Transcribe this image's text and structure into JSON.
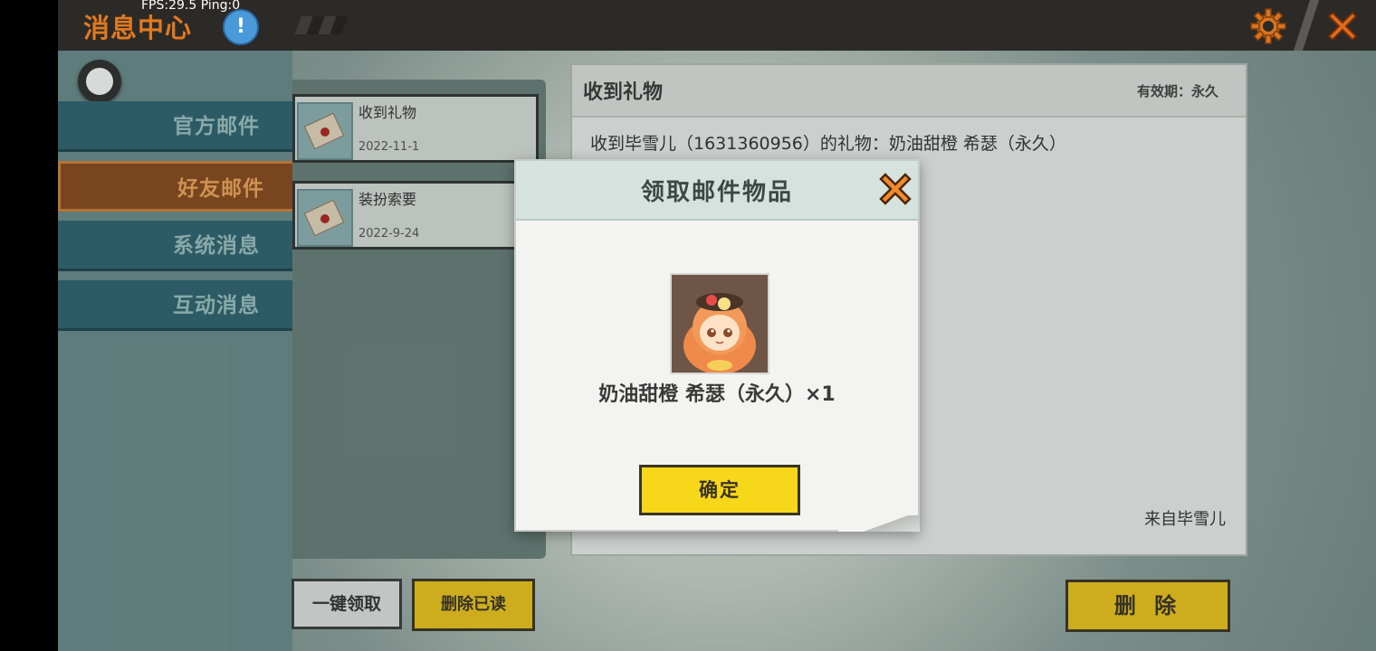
{
  "topbar": {
    "title": "消息中心",
    "fps_text": "FPS:29.5  Ping:0",
    "info_icon": "info-icon",
    "settings_icon": "gear-icon",
    "close_icon": "close-icon"
  },
  "sidebar": {
    "items": [
      {
        "label": "官方邮件"
      },
      {
        "label": "好友邮件"
      },
      {
        "label": "系统消息"
      },
      {
        "label": "互动消息"
      }
    ],
    "active_index": 1
  },
  "mail_list": [
    {
      "title": "收到礼物",
      "date": "2022-11-1"
    },
    {
      "title": "装扮索要",
      "date": "2022-9-24"
    }
  ],
  "detail": {
    "title": "收到礼物",
    "validity": "有效期：永久",
    "body": "收到毕雪儿（1631360956）的礼物：奶油甜橙 希瑟（永久）",
    "from": "来自毕雪儿"
  },
  "buttons": {
    "claim_all": "一键领取",
    "delete_read": "删除已读",
    "delete": "删 除"
  },
  "modal": {
    "title": "领取邮件物品",
    "item_name": "奶油甜橙 希瑟（永久）×1",
    "ok_label": "确定"
  },
  "colors": {
    "accent_orange": "#e07a21",
    "nav_teal": "#2f6571",
    "button_yellow": "#f2c81a"
  }
}
